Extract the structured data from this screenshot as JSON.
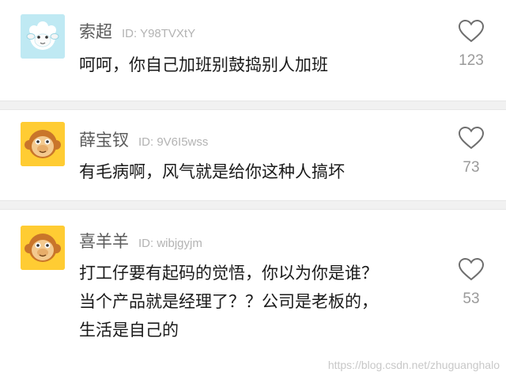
{
  "comments": [
    {
      "username": "索超",
      "user_id": "ID: Y98TVXtY",
      "avatar": "sheep-avatar",
      "lines": [
        "呵呵，你自己加班别鼓捣别人加班"
      ],
      "likes": "123"
    },
    {
      "username": "薛宝钗",
      "user_id": "ID: 9V6I5wss",
      "avatar": "monkey-avatar",
      "lines": [
        "有毛病啊，风气就是给你这种人搞坏"
      ],
      "likes": "73"
    },
    {
      "username": "喜羊羊",
      "user_id": "ID: wibjgyjm",
      "avatar": "monkey-avatar",
      "lines": [
        "打工仔要有起码的觉悟，你以为你是谁？",
        "当个产品就是经理了？？公司是老板的，",
        "生活是自己的"
      ],
      "likes": "53"
    }
  ],
  "watermark": "https://blog.csdn.net/zhuguanghalo",
  "colors": {
    "separator": "#f1f1f1",
    "username": "#5a5a5a",
    "user_id": "#b3b3b3",
    "text": "#1a1a1a",
    "like_count": "#9a9a9a"
  }
}
